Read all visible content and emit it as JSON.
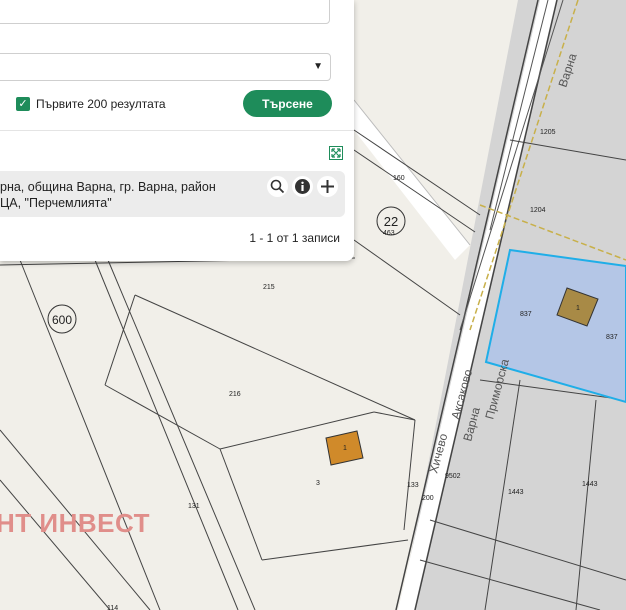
{
  "panel": {
    "top_limit_label": "Първите 200 резултата",
    "search_button": "Търсене",
    "result_line1": "рна, община Варна, гр. Варна, район",
    "result_line2": "ЦА, \"Перчемлията\"",
    "pagination": "1 - 1 от 1 записи"
  },
  "map": {
    "road_labels": {
      "top_right": "Варна",
      "road_east": "Приморска",
      "road_left": "Аксаково",
      "road_right": "Варна",
      "road_bottom": "Хичево"
    },
    "badges": [
      "22",
      "600"
    ],
    "parcel_numbers": [
      "1205",
      "1204",
      "160",
      "463",
      "215",
      "216",
      "837",
      "837",
      "131",
      "3",
      "133",
      "200",
      "9502",
      "1443",
      "1443",
      "114"
    ],
    "building_labels": [
      "1",
      "1"
    ],
    "watermark": "НТ ИНВЕСТ"
  },
  "colors": {
    "accent": "#1e8c5a",
    "selected_parcel_fill": "#b4c6e6",
    "selected_parcel_stroke": "#1faee8",
    "building_fill": "#a88a46",
    "watermark": "#e08e8a"
  }
}
